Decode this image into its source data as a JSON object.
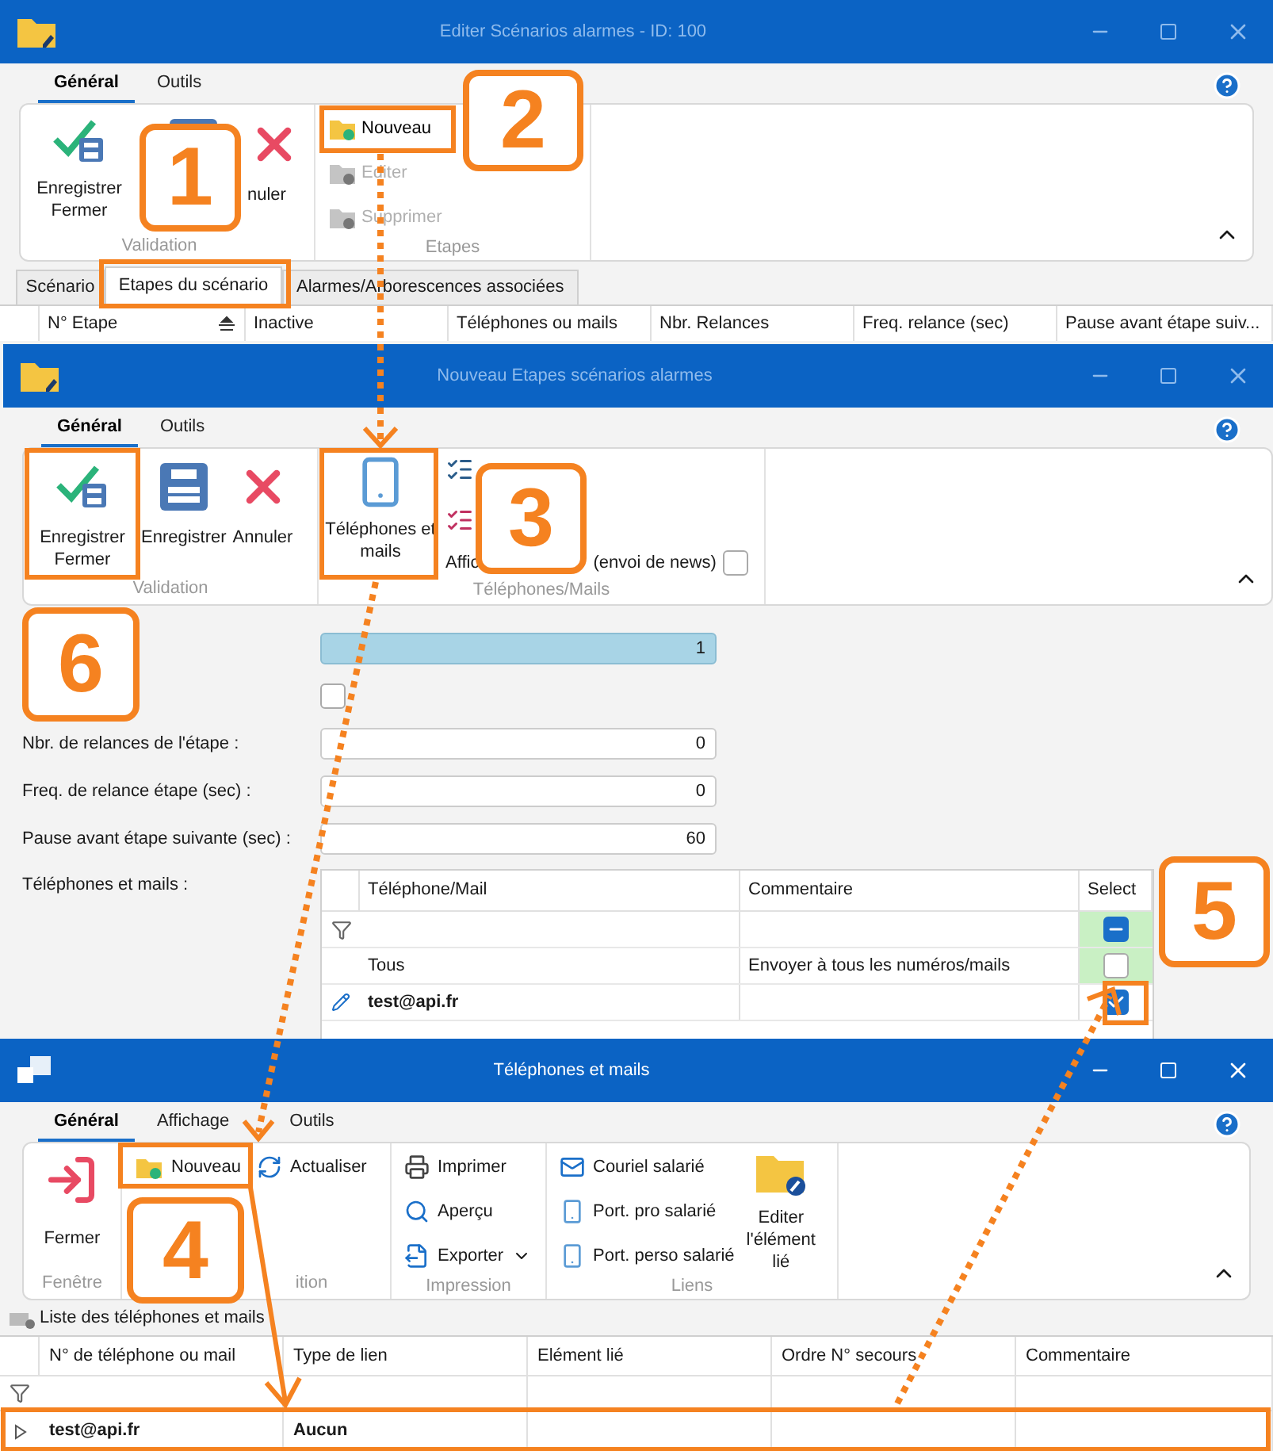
{
  "editor_window": {
    "title": "Editer Scénarios alarmes - ID: 100",
    "ribbon_tabs": [
      {
        "label": "Général",
        "selected": true
      },
      {
        "label": "Outils",
        "selected": false
      }
    ],
    "validation_group": {
      "label": "Validation",
      "buttons": [
        {
          "label": "Enregistrer Fermer"
        },
        {
          "label": "nuler"
        }
      ]
    },
    "steps_group": {
      "label": "Etapes",
      "buttons": [
        {
          "label": "Nouveau",
          "disabled": false
        },
        {
          "label": "Editer",
          "disabled": true
        },
        {
          "label": "Supprimer",
          "disabled": true
        }
      ]
    },
    "tabs": [
      {
        "label": "Scénario",
        "selected": false
      },
      {
        "label": "Etapes du scénario",
        "selected": true
      },
      {
        "label": "Alarmes/Arborescences associées",
        "selected": false
      }
    ],
    "table": {
      "columns": [
        "N° Etape",
        "Inactive",
        "Téléphones ou mails",
        "Nbr. Relances",
        "Freq. relance (sec)",
        "Pause avant étape suiv..."
      ]
    }
  },
  "step_window": {
    "title": "Nouveau Etapes scénarios alarmes",
    "ribbon_tabs": [
      {
        "label": "Général",
        "selected": true
      },
      {
        "label": "Outils",
        "selected": false
      }
    ],
    "validation_group": {
      "label": "Validation",
      "buttons": [
        {
          "label": "Enregistrer Fermer"
        },
        {
          "label": "Enregistrer"
        },
        {
          "label": "Annuler"
        }
      ]
    },
    "phones_group": {
      "label": "Téléphones/Mails",
      "buttons": [
        {
          "label": "Téléphones et mails"
        }
      ],
      "option_start": "Affic",
      "option_end": "(envoi de news)",
      "option_checked": false
    },
    "form": [
      {
        "kind": "readonly",
        "value": "1"
      },
      {
        "kind": "checkbox",
        "checked": false
      },
      {
        "kind": "number",
        "label": "Nbr. de relances de l'étape :",
        "value": "0"
      },
      {
        "kind": "number",
        "label": "Freq. de relance étape (sec) :",
        "value": "0"
      },
      {
        "kind": "number",
        "label": "Pause avant étape suivante (sec) :",
        "value": "60"
      }
    ],
    "phones_label": "Téléphones et mails :",
    "grid": {
      "columns": [
        "Téléphone/Mail",
        "Commentaire",
        "Select"
      ],
      "filter_row": {
        "indeterminate": true,
        "highlighted": true
      },
      "rows": [
        {
          "phone": "Tous",
          "comment": "Envoyer à tous les numéros/mails",
          "bold": false,
          "editing": false,
          "highlighted": true,
          "checked": false
        },
        {
          "phone": "test@api.fr",
          "bold": true,
          "editing": true,
          "highlighted": false,
          "checked": true
        }
      ]
    }
  },
  "phones_window": {
    "title": "Téléphones et mails",
    "ribbon_tabs": [
      {
        "label": "Général",
        "selected": true
      },
      {
        "label": "Affichage",
        "selected": false
      },
      {
        "label": "Outils",
        "selected": false
      }
    ],
    "window_group": {
      "label": "Fenêtre",
      "buttons": [
        "Fermer"
      ]
    },
    "edition_group": {
      "label": "ition",
      "buttons": [
        "Nouveau",
        "Actualiser"
      ]
    },
    "print_group": {
      "label": "Impression",
      "buttons": [
        "Imprimer",
        "Aperçu",
        "Exporter"
      ]
    },
    "links_group": {
      "label": "Liens",
      "buttons": [
        "Couriel salarié",
        "Port. pro salarié",
        "Port. perso salarié",
        "Editer l'élément lié"
      ]
    },
    "list_title": "Liste des téléphones et mails",
    "table": {
      "columns": [
        "N° de téléphone ou mail",
        "Type de lien",
        "Elément lié",
        "Ordre N° secours",
        "Commentaire"
      ],
      "rows": [
        {
          "cells": [
            "test@api.fr",
            "Aucun"
          ]
        }
      ]
    }
  },
  "callouts": [
    {
      "number": "1"
    },
    {
      "number": "2"
    },
    {
      "number": "3"
    },
    {
      "number": "4"
    },
    {
      "number": "5"
    },
    {
      "number": "6"
    }
  ]
}
